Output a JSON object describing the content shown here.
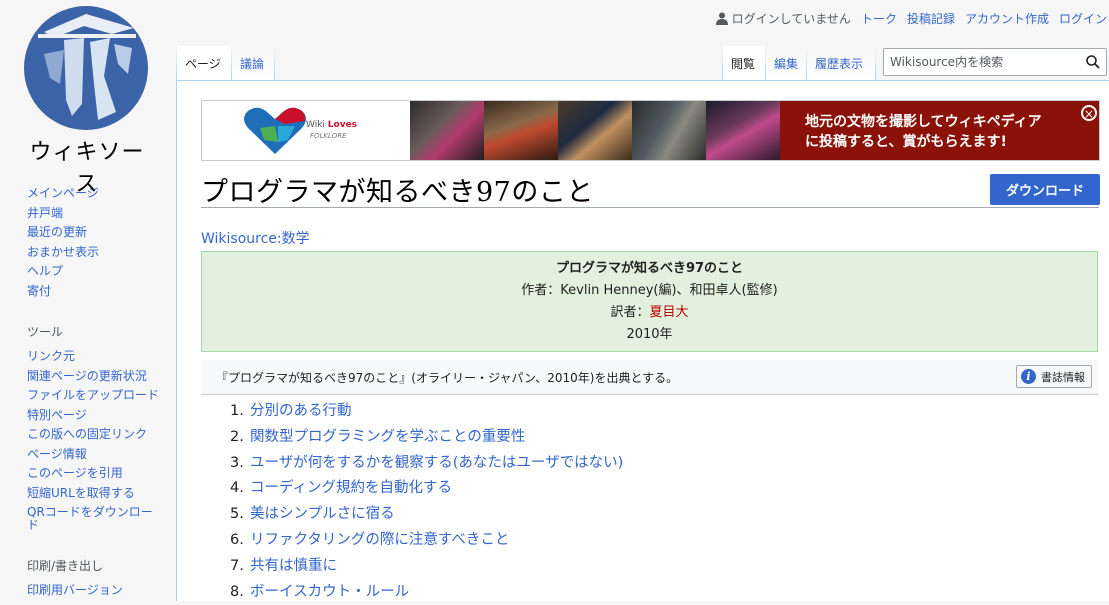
{
  "logo": {
    "text": "ウィキソース"
  },
  "personal": {
    "not_logged_in": "ログインしていません",
    "links": [
      "トーク",
      "投稿記録",
      "アカウント作成",
      "ログイン"
    ]
  },
  "sidebar": {
    "nav": [
      "メインページ",
      "井戸端",
      "最近の更新",
      "おまかせ表示",
      "ヘルプ",
      "寄付"
    ],
    "tools_heading": "ツール",
    "tools": [
      "リンク元",
      "関連ページの更新状況",
      "ファイルをアップロード",
      "特別ページ",
      "この版への固定リンク",
      "ページ情報",
      "このページを引用",
      "短縮URLを取得する",
      "QRコードをダウンロード"
    ],
    "print_heading": "印刷/書き出し",
    "print": [
      "印刷用バージョン"
    ]
  },
  "tabs": {
    "page": "ページ",
    "talk": "議論",
    "read": "閲覧",
    "edit": "編集",
    "history": "履歴表示"
  },
  "search": {
    "placeholder": "Wikisource内を検索"
  },
  "banner": {
    "wiki_loves": "Wiki Loves",
    "folklore": "FOLKLORE",
    "message_line1": "地元の文物を撮影してウィキペディア",
    "message_line2": "に投稿すると、賞がもらえます!"
  },
  "page": {
    "title": "プログラマが知るべき97のこと",
    "download": "ダウンロード",
    "category": "Wikisource:数学"
  },
  "header": {
    "title": "プログラマが知るべき97のこと",
    "author": "作者：Kevlin Henney(編)、和田卓人(監修)",
    "translator_label": "訳者：",
    "translator": "夏目大",
    "year": "2010年"
  },
  "source": {
    "text": "『プログラマが知るべき97のこと』(オライリー・ジャパン、2010年)を出典とする。",
    "biblio": "書誌情報"
  },
  "toc": [
    {
      "num": "1.",
      "label": "分別のある行動"
    },
    {
      "num": "2.",
      "label": "関数型プログラミングを学ぶことの重要性"
    },
    {
      "num": "3.",
      "label": "ユーザが何をするかを観察する(あなたはユーザではない)"
    },
    {
      "num": "4.",
      "label": "コーディング規約を自動化する"
    },
    {
      "num": "5.",
      "label": "美はシンプルさに宿る"
    },
    {
      "num": "6.",
      "label": "リファクタリングの際に注意すべきこと"
    },
    {
      "num": "7.",
      "label": "共有は慎重に"
    },
    {
      "num": "8.",
      "label": "ボーイスカウト・ルール"
    }
  ]
}
